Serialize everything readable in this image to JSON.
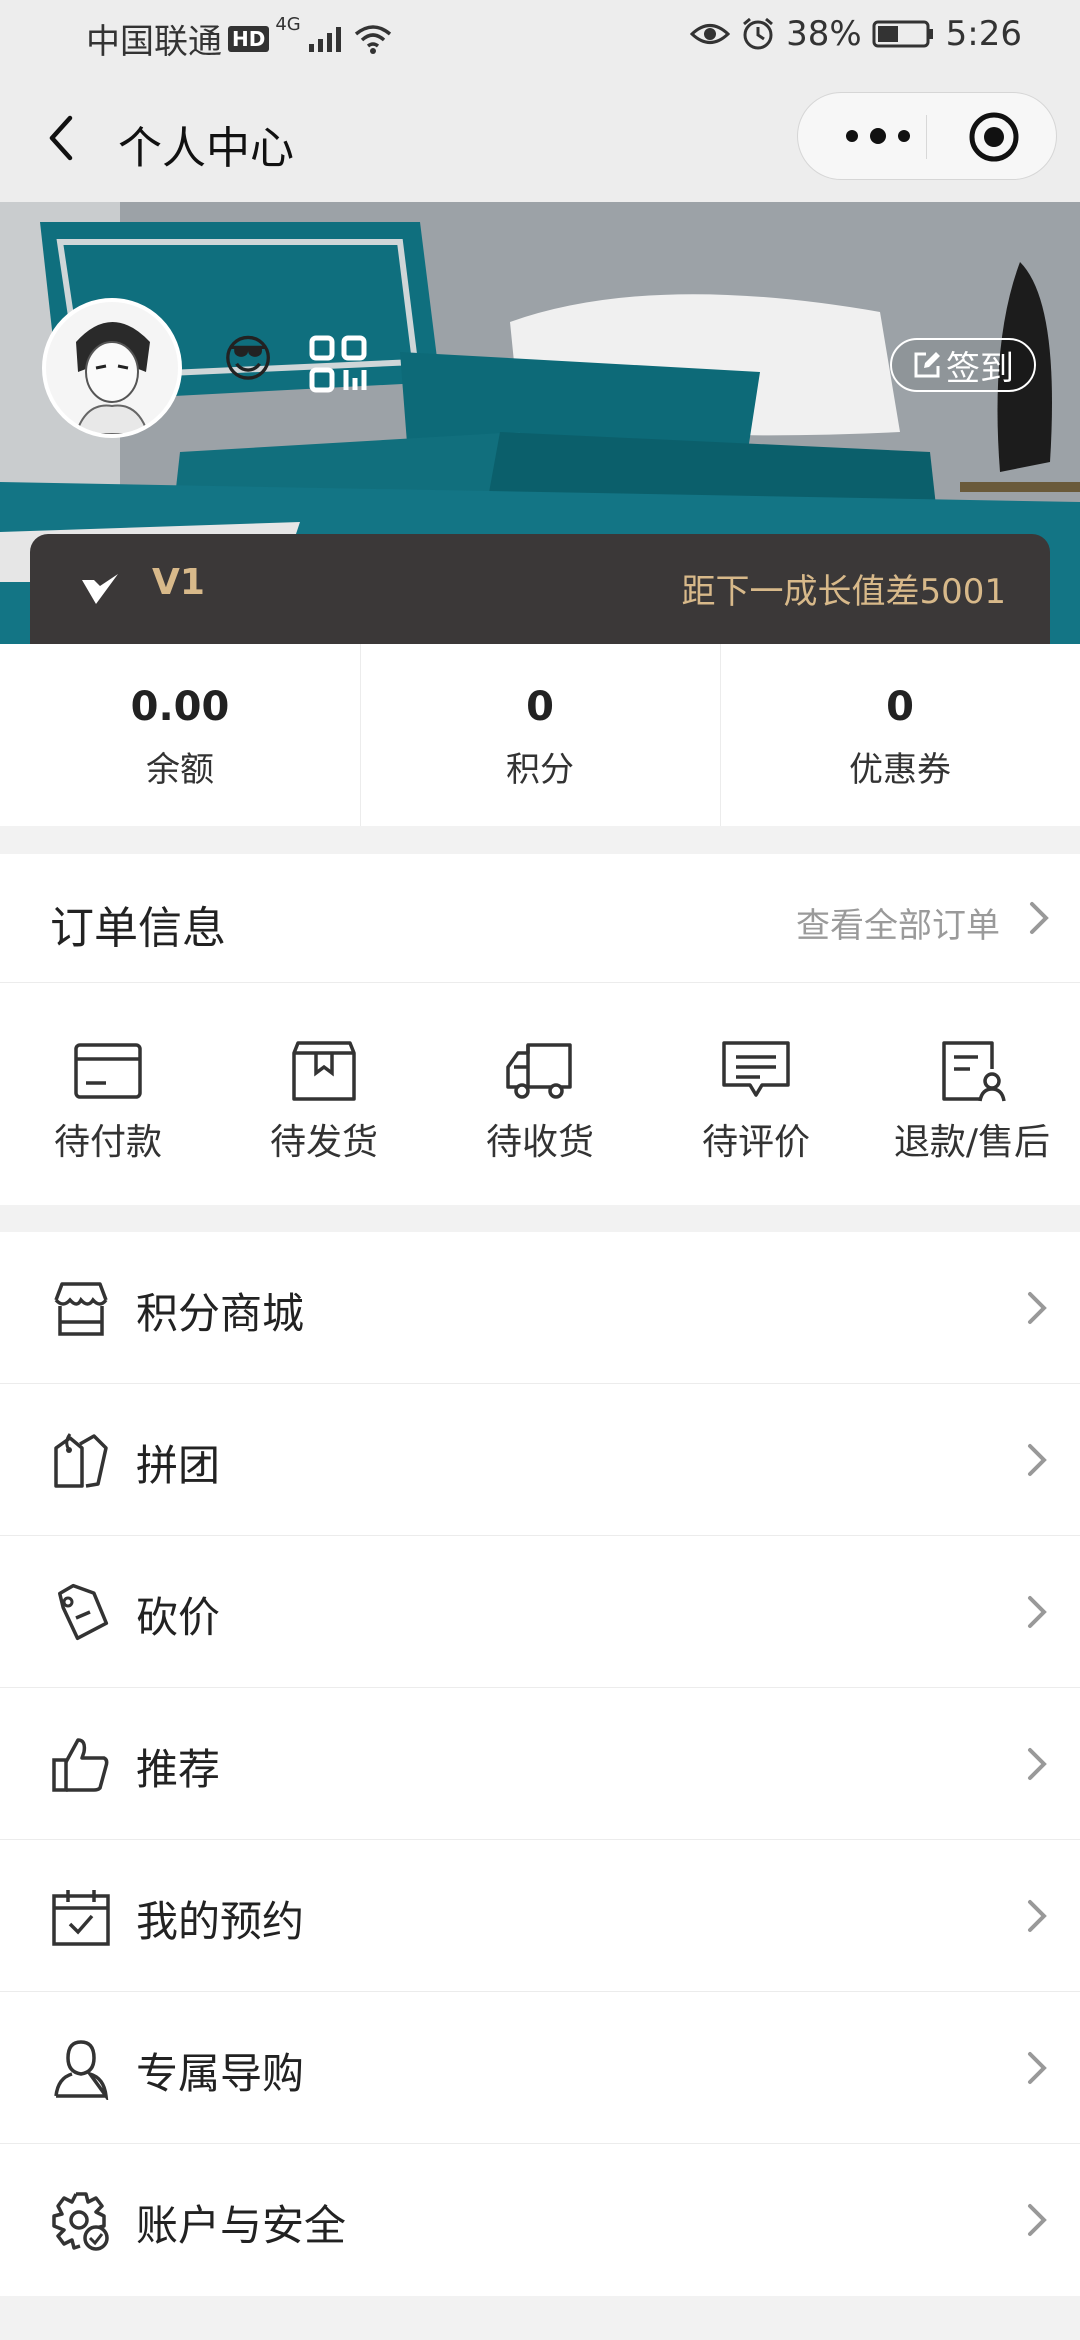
{
  "status_bar": {
    "carrier": "中国联通",
    "hd": "HD",
    "network": "4G",
    "battery": "38%",
    "time": "5:26"
  },
  "nav": {
    "title": "个人中心"
  },
  "profile": {
    "emoji": "😎",
    "signin_label": "签到"
  },
  "vip": {
    "level": "V1",
    "next_level_text": "距下一成长值差5001"
  },
  "stats": [
    {
      "value": "0.00",
      "label": "余额"
    },
    {
      "value": "0",
      "label": "积分"
    },
    {
      "value": "0",
      "label": "优惠券"
    }
  ],
  "orders": {
    "title": "订单信息",
    "view_all": "查看全部订单",
    "items": [
      {
        "label": "待付款",
        "icon": "card-icon"
      },
      {
        "label": "待发货",
        "icon": "box-icon"
      },
      {
        "label": "待收货",
        "icon": "truck-icon"
      },
      {
        "label": "待评价",
        "icon": "comment-icon"
      },
      {
        "label": "退款/售后",
        "icon": "refund-icon"
      }
    ]
  },
  "menu": [
    {
      "label": "积分商城",
      "icon": "store-icon"
    },
    {
      "label": "拼团",
      "icon": "group-tag-icon"
    },
    {
      "label": "砍价",
      "icon": "price-tag-icon"
    },
    {
      "label": "推荐",
      "icon": "thumbs-up-icon"
    },
    {
      "label": "我的预约",
      "icon": "calendar-icon"
    },
    {
      "label": "专属导购",
      "icon": "person-icon"
    },
    {
      "label": "账户与安全",
      "icon": "gear-shield-icon"
    }
  ],
  "colors": {
    "vip_bg": "#3b3838",
    "vip_text": "#d8b98a",
    "page_bg": "#f2f2f2"
  }
}
